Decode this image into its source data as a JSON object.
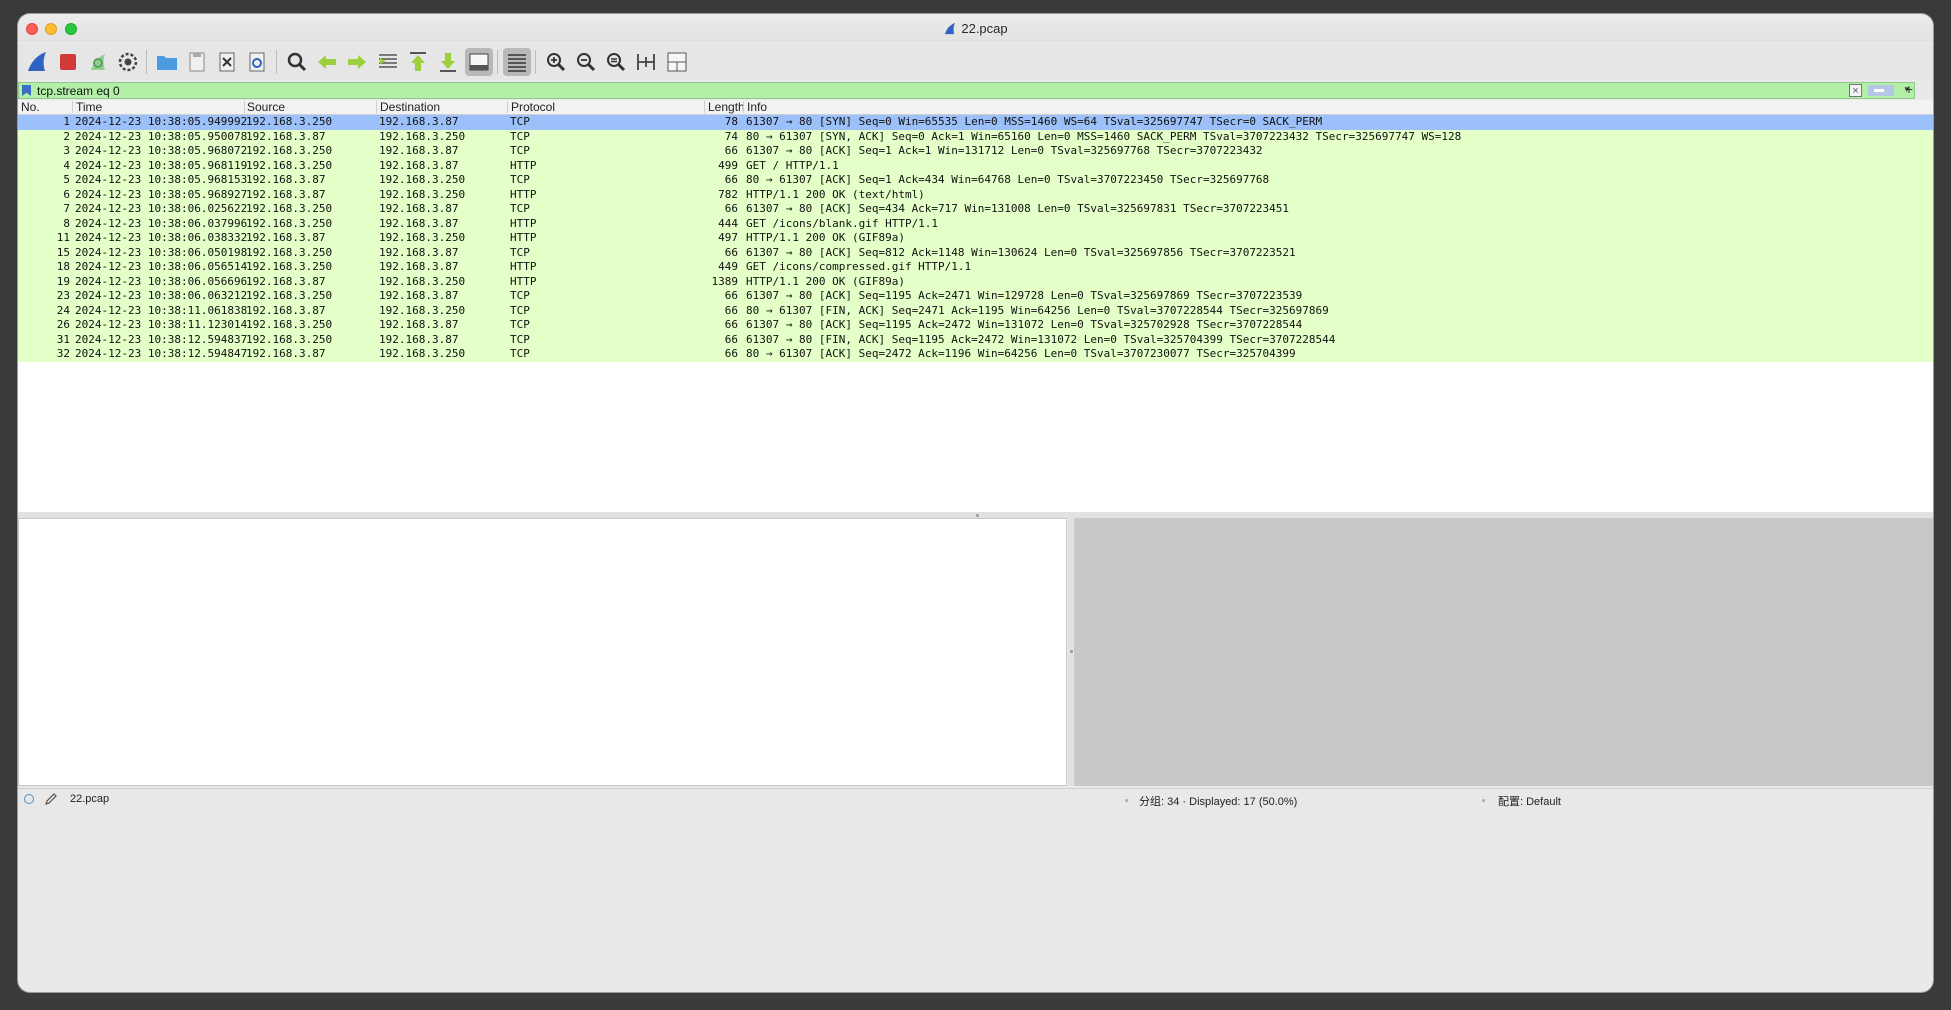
{
  "window": {
    "title": "22.pcap"
  },
  "toolbar": {
    "buttons": [
      "start-capture-icon",
      "stop-capture-icon",
      "restart-capture-icon",
      "capture-options-icon",
      "open-file-icon",
      "save-file-icon",
      "close-file-icon",
      "reload-file-icon",
      "find-packet-icon",
      "go-back-icon",
      "go-forward-icon",
      "go-to-packet-icon",
      "go-first-packet-icon",
      "go-last-packet-icon",
      "auto-scroll-icon",
      "colorize-icon",
      "zoom-in-icon",
      "zoom-out-icon",
      "zoom-normal-icon",
      "resize-columns-icon",
      "layout-icon"
    ]
  },
  "filter": {
    "value": "tcp.stream eq 0",
    "add_label": "+"
  },
  "columns": {
    "no": "No.",
    "time": "Time",
    "source": "Source",
    "destination": "Destination",
    "protocol": "Protocol",
    "length": "Length",
    "info": "Info"
  },
  "packets": [
    {
      "no": "1",
      "time": "2024-12-23 10:38:05.949992",
      "src": "192.168.3.250",
      "dst": "192.168.3.87",
      "proto": "TCP",
      "len": "78",
      "info": "61307 → 80 [SYN] Seq=0 Win=65535 Len=0 MSS=1460 WS=64 TSval=325697747 TSecr=0 SACK_PERM",
      "selected": true
    },
    {
      "no": "2",
      "time": "2024-12-23 10:38:05.950078",
      "src": "192.168.3.87",
      "dst": "192.168.3.250",
      "proto": "TCP",
      "len": "74",
      "info": "80 → 61307 [SYN, ACK] Seq=0 Ack=1 Win=65160 Len=0 MSS=1460 SACK_PERM TSval=3707223432 TSecr=325697747 WS=128"
    },
    {
      "no": "3",
      "time": "2024-12-23 10:38:05.968072",
      "src": "192.168.3.250",
      "dst": "192.168.3.87",
      "proto": "TCP",
      "len": "66",
      "info": "61307 → 80 [ACK] Seq=1 Ack=1 Win=131712 Len=0 TSval=325697768 TSecr=3707223432"
    },
    {
      "no": "4",
      "time": "2024-12-23 10:38:05.968119",
      "src": "192.168.3.250",
      "dst": "192.168.3.87",
      "proto": "HTTP",
      "len": "499",
      "info": "GET / HTTP/1.1"
    },
    {
      "no": "5",
      "time": "2024-12-23 10:38:05.968153",
      "src": "192.168.3.87",
      "dst": "192.168.3.250",
      "proto": "TCP",
      "len": "66",
      "info": "80 → 61307 [ACK] Seq=1 Ack=434 Win=64768 Len=0 TSval=3707223450 TSecr=325697768"
    },
    {
      "no": "6",
      "time": "2024-12-23 10:38:05.968927",
      "src": "192.168.3.87",
      "dst": "192.168.3.250",
      "proto": "HTTP",
      "len": "782",
      "info": "HTTP/1.1 200 OK  (text/html)"
    },
    {
      "no": "7",
      "time": "2024-12-23 10:38:06.025622",
      "src": "192.168.3.250",
      "dst": "192.168.3.87",
      "proto": "TCP",
      "len": "66",
      "info": "61307 → 80 [ACK] Seq=434 Ack=717 Win=131008 Len=0 TSval=325697831 TSecr=3707223451"
    },
    {
      "no": "8",
      "time": "2024-12-23 10:38:06.037996",
      "src": "192.168.3.250",
      "dst": "192.168.3.87",
      "proto": "HTTP",
      "len": "444",
      "info": "GET /icons/blank.gif HTTP/1.1"
    },
    {
      "no": "11",
      "time": "2024-12-23 10:38:06.038332",
      "src": "192.168.3.87",
      "dst": "192.168.3.250",
      "proto": "HTTP",
      "len": "497",
      "info": "HTTP/1.1 200 OK  (GIF89a)"
    },
    {
      "no": "15",
      "time": "2024-12-23 10:38:06.050198",
      "src": "192.168.3.250",
      "dst": "192.168.3.87",
      "proto": "TCP",
      "len": "66",
      "info": "61307 → 80 [ACK] Seq=812 Ack=1148 Win=130624 Len=0 TSval=325697856 TSecr=3707223521"
    },
    {
      "no": "18",
      "time": "2024-12-23 10:38:06.056514",
      "src": "192.168.3.250",
      "dst": "192.168.3.87",
      "proto": "HTTP",
      "len": "449",
      "info": "GET /icons/compressed.gif HTTP/1.1"
    },
    {
      "no": "19",
      "time": "2024-12-23 10:38:06.056696",
      "src": "192.168.3.87",
      "dst": "192.168.3.250",
      "proto": "HTTP",
      "len": "1389",
      "info": "HTTP/1.1 200 OK  (GIF89a)"
    },
    {
      "no": "23",
      "time": "2024-12-23 10:38:06.063212",
      "src": "192.168.3.250",
      "dst": "192.168.3.87",
      "proto": "TCP",
      "len": "66",
      "info": "61307 → 80 [ACK] Seq=1195 Ack=2471 Win=129728 Len=0 TSval=325697869 TSecr=3707223539"
    },
    {
      "no": "24",
      "time": "2024-12-23 10:38:11.061838",
      "src": "192.168.3.87",
      "dst": "192.168.3.250",
      "proto": "TCP",
      "len": "66",
      "info": "80 → 61307 [FIN, ACK] Seq=2471 Ack=1195 Win=64256 Len=0 TSval=3707228544 TSecr=325697869"
    },
    {
      "no": "26",
      "time": "2024-12-23 10:38:11.123014",
      "src": "192.168.3.250",
      "dst": "192.168.3.87",
      "proto": "TCP",
      "len": "66",
      "info": "61307 → 80 [ACK] Seq=1195 Ack=2472 Win=131072 Len=0 TSval=325702928 TSecr=3707228544"
    },
    {
      "no": "31",
      "time": "2024-12-23 10:38:12.594837",
      "src": "192.168.3.250",
      "dst": "192.168.3.87",
      "proto": "TCP",
      "len": "66",
      "info": "61307 → 80 [FIN, ACK] Seq=1195 Ack=2472 Win=131072 Len=0 TSval=325704399 TSecr=3707228544"
    },
    {
      "no": "32",
      "time": "2024-12-23 10:38:12.594847",
      "src": "192.168.3.87",
      "dst": "192.168.3.250",
      "proto": "TCP",
      "len": "66",
      "info": "80 → 61307 [ACK] Seq=2472 Ack=1196 Win=64256 Len=0 TSval=3707230077 TSecr=325704399"
    }
  ],
  "status": {
    "filename": "22.pcap",
    "stats": "分组: 34 · Displayed: 17 (50.0%)",
    "profile": "配置: Default"
  },
  "colors": {
    "row_tcp_http": "#e4ffc7",
    "row_selected": "#9cc0f9",
    "filter_valid": "#b2f0a8"
  }
}
